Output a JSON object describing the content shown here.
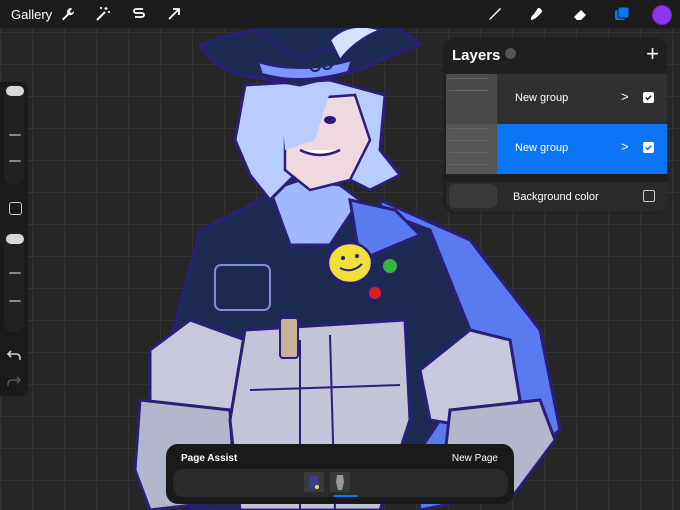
{
  "toolbar": {
    "gallery_label": "Gallery",
    "active_color": "#8f35f0",
    "accent": "#0a76f6",
    "left_tools": [
      "wrench-icon",
      "magic-wand-icon",
      "selection-icon",
      "transform-arrow-icon"
    ],
    "right_tools": [
      "brush-icon",
      "smudge-icon",
      "eraser-icon",
      "layers-icon"
    ]
  },
  "sidebar": {
    "items": [
      "brush-size-slider",
      "modifier-button",
      "opacity-slider",
      "undo-icon",
      "redo-icon"
    ]
  },
  "layers_panel": {
    "title": "Layers",
    "add_icon": "+",
    "layers": [
      {
        "name": "New group",
        "chevron": ">",
        "visible": true,
        "selected": false
      },
      {
        "name": "New group",
        "chevron": ">",
        "visible": true,
        "selected": true
      }
    ],
    "background": {
      "name": "Background color",
      "visible": false
    }
  },
  "page_assist": {
    "title": "Page Assist",
    "new_page_label": "New Page",
    "pages": [
      "page-1-thumbnail",
      "page-2-thumbnail"
    ],
    "active_page": 2
  }
}
